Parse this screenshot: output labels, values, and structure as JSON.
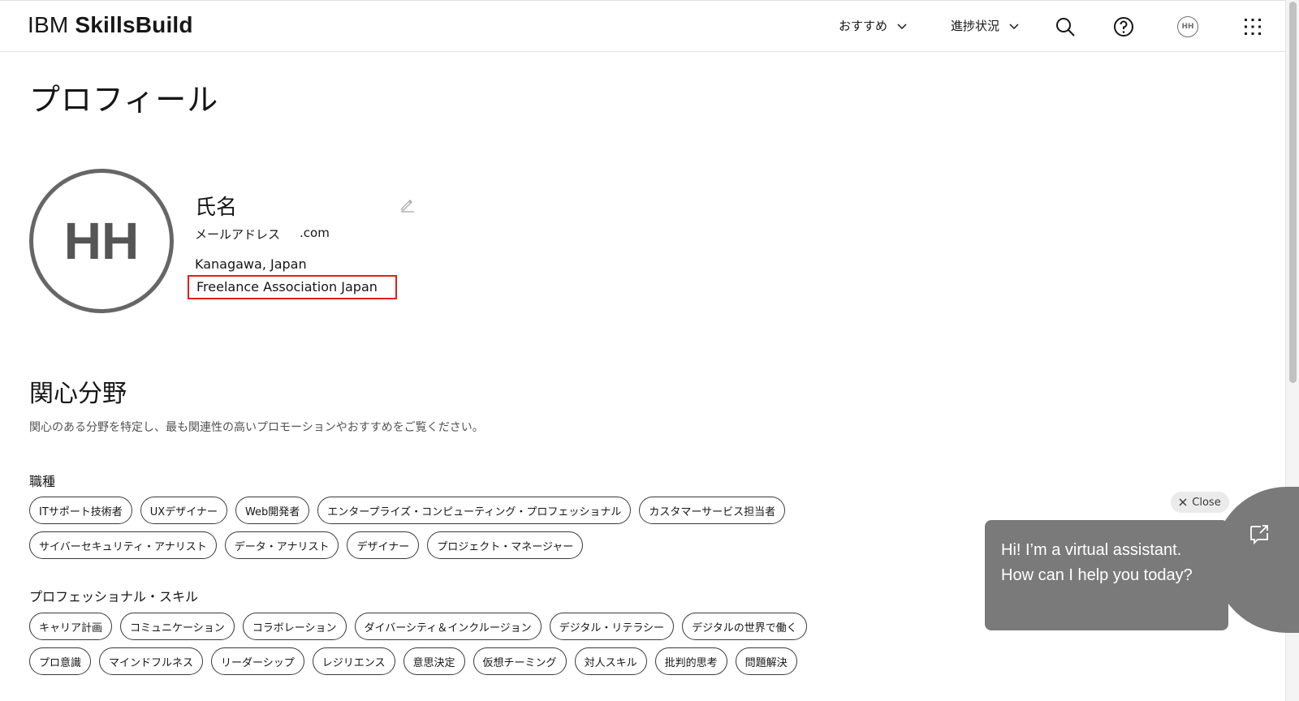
{
  "header": {
    "brand_regular": "IBM",
    "brand_bold": "SkillsBuild",
    "nav": [
      {
        "label": "おすすめ"
      },
      {
        "label": "進捗状況"
      }
    ],
    "icons": [
      "search-icon",
      "help-icon",
      "avatar",
      "app-switcher-icon"
    ],
    "avatar_initials": "HH"
  },
  "profile": {
    "page_title": "プロフィール",
    "avatar_initials": "HH",
    "name_label": "氏名",
    "email_label": "メールアドレス",
    "email_suffix": ".com",
    "location": "Kanagawa, Japan",
    "organization": "Freelance Association Japan"
  },
  "interests": {
    "title": "関心分野",
    "description": "関心のある分野を特定し、最も関連性の高いプロモーションやおすすめをご覧ください。",
    "job_roles_label": "職種",
    "job_roles_row1": [
      "ITサポート技術者",
      "UXデザイナー",
      "Web開発者",
      "エンタープライズ・コンピューティング・プロフェッショナル",
      "カスタマーサービス担当者"
    ],
    "job_roles_row2": [
      "サイバーセキュリティ・アナリスト",
      "データ・アナリスト",
      "デザイナー",
      "プロジェクト・マネージャー"
    ],
    "skills_label": "プロフェッショナル・スキル",
    "skills_row1": [
      "キャリア計画",
      "コミュニケーション",
      "コラボレーション",
      "ダイバーシティ＆インクルージョン",
      "デジタル・リテラシー",
      "デジタルの世界で働く"
    ],
    "skills_row2": [
      "プロ意識",
      "マインドフルネス",
      "リーダーシップ",
      "レジリエンス",
      "意思決定",
      "仮想チーミング",
      "対人スキル",
      "批判的思考",
      "問題解決"
    ]
  },
  "assistant": {
    "close_label": "Close",
    "message": "Hi! I’m a virtual assistant. How can I help you today?"
  },
  "colors": {
    "highlight": "#e0201a",
    "assistant_bg": "#7a7a7a"
  }
}
